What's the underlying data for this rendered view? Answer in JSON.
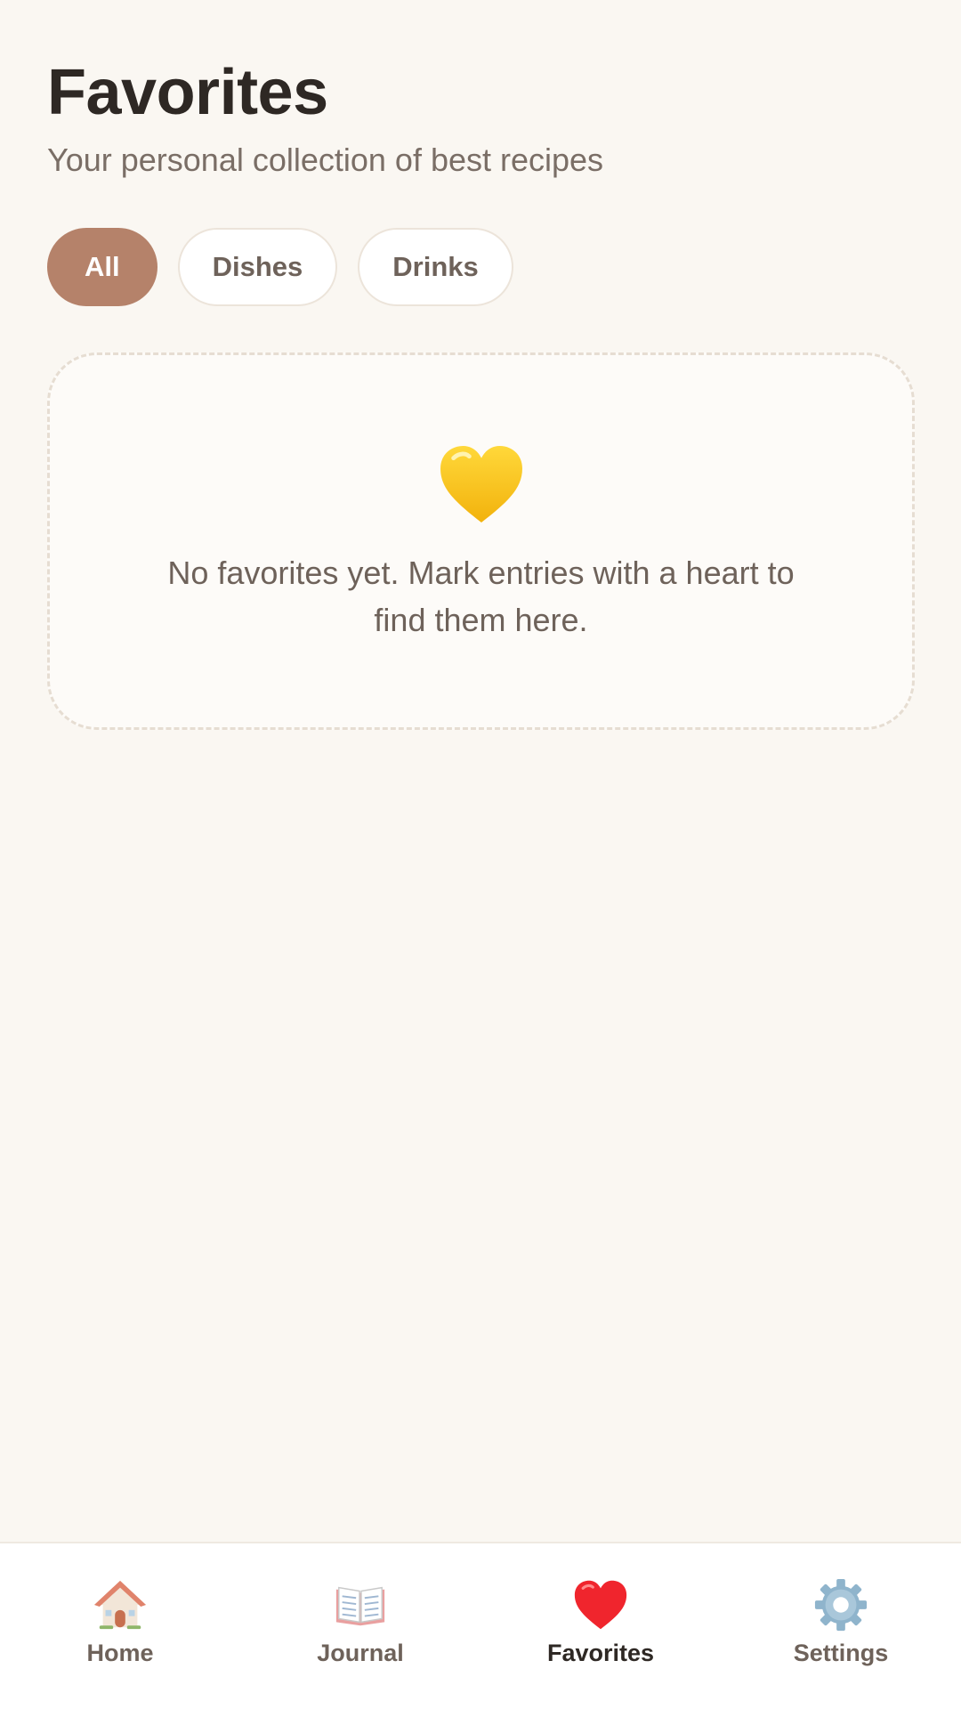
{
  "header": {
    "title": "Favorites",
    "subtitle": "Your personal collection of best recipes"
  },
  "filters": {
    "items": [
      {
        "label": "All",
        "active": true
      },
      {
        "label": "Dishes",
        "active": false
      },
      {
        "label": "Drinks",
        "active": false
      }
    ]
  },
  "empty_state": {
    "icon": "yellow-heart-icon",
    "message": "No favorites yet. Mark entries with a heart to find them here."
  },
  "bottom_nav": {
    "items": [
      {
        "label": "Home",
        "icon": "house-icon",
        "active": false
      },
      {
        "label": "Journal",
        "icon": "open-book-icon",
        "active": false
      },
      {
        "label": "Favorites",
        "icon": "red-heart-icon",
        "active": true
      },
      {
        "label": "Settings",
        "icon": "gear-icon",
        "active": false
      }
    ]
  },
  "colors": {
    "background": "#faf7f2",
    "accent": "#b5826a",
    "text_primary": "#2e2824",
    "text_secondary": "#6e625a"
  }
}
